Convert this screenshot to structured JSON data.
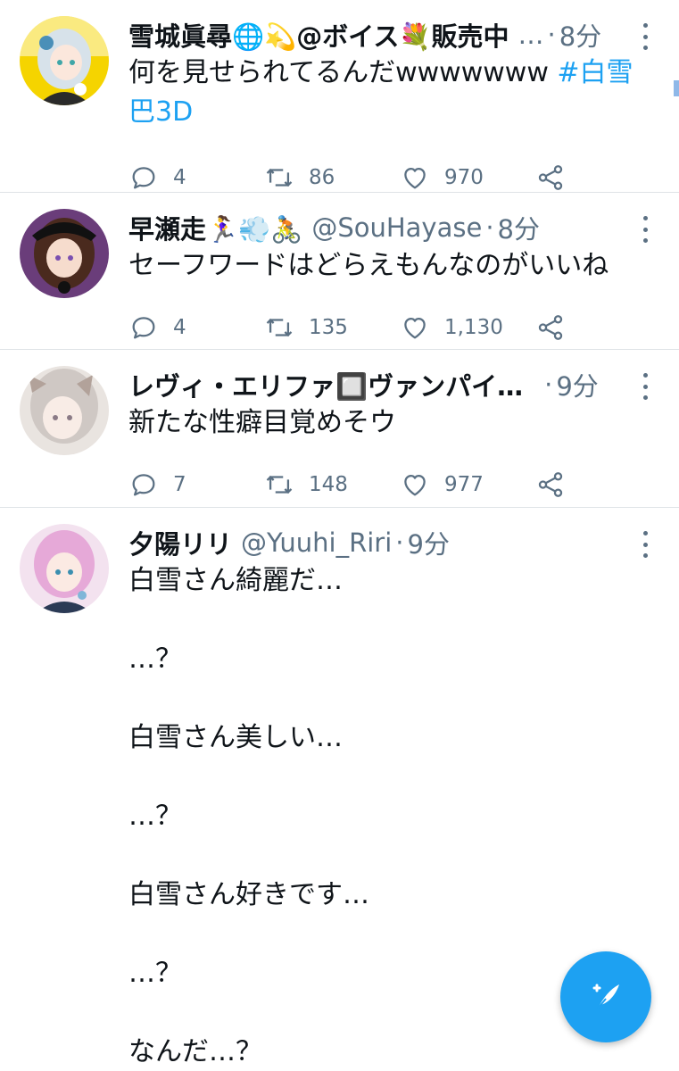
{
  "tweets": [
    {
      "name": "雪城眞尋🌐💫@ボイス💐販売中",
      "handle": "…",
      "time": "8分",
      "text_plain": "何を見せられてるんだwwwwwww ",
      "hashtag": "#白雪巴3D",
      "replies": "4",
      "retweets": "86",
      "likes": "970",
      "avatar": {
        "bg": "#f5d400",
        "hair": "#d7e2ea",
        "accent": "#2a2a2a"
      }
    },
    {
      "name": "早瀬走🏃‍♀️💨🚴",
      "handle": "@SouHayase",
      "time": "8分",
      "text": "セーフワードはどらえもんなのがいいね",
      "replies": "4",
      "retweets": "135",
      "likes": "1,130",
      "avatar": {
        "bg": "#6a3d7a",
        "hair": "#4a2a1e",
        "accent": "#111111"
      }
    },
    {
      "name": "レヴィ・エリファ🔲ヴァンパイ…",
      "handle": "",
      "time": "9分",
      "text": "新たな性癖目覚めそウ",
      "replies": "7",
      "retweets": "148",
      "likes": "977",
      "avatar": {
        "bg": "#e9e4e0",
        "hair": "#cfc8c4",
        "accent": "#b2a29a"
      }
    },
    {
      "name": "夕陽リリ",
      "handle": "@Yuuhi_Riri",
      "time": "9分",
      "lines": [
        "白雪さん綺麗だ…",
        "…？",
        "白雪さん美しい…",
        "…？",
        "白雪さん好きです…",
        "…？",
        "なんだ…？"
      ],
      "avatar": {
        "bg": "#f3e2ef",
        "hair": "#e6a9d8",
        "accent": "#2b3a55"
      }
    }
  ],
  "colors": {
    "accent": "#1da1f2",
    "muted": "#5b7083",
    "divider": "#dfe3e7"
  },
  "icons": [
    "reply-icon",
    "retweet-icon",
    "like-icon",
    "share-icon",
    "more-icon",
    "compose-icon"
  ]
}
